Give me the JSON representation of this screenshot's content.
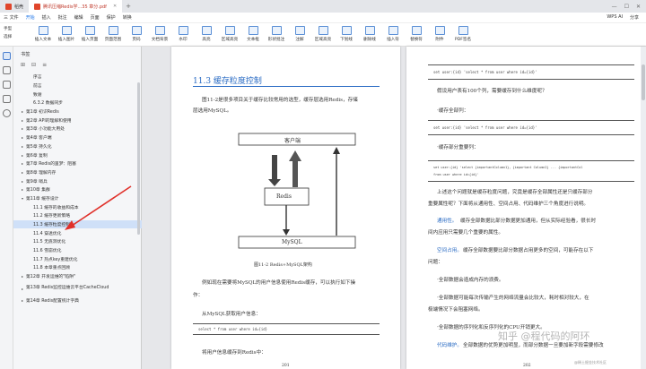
{
  "tabs": [
    {
      "label": "稻壳",
      "color": "#e0452b",
      "active": false
    },
    {
      "label": "腾讯压缩Redis学...35 章分.pdf",
      "color": "#e0452b",
      "active": true
    }
  ],
  "menubar": {
    "items": [
      "三 文件",
      "开始",
      "插入",
      "批注",
      "编辑",
      "页面",
      "保护",
      "转换"
    ],
    "right": [
      "WPS AI",
      "分享"
    ]
  },
  "ribbon": [
    {
      "label": "手型",
      "type": "col2",
      "label2": "选择"
    },
    {
      "label": "插入文本"
    },
    {
      "label": "插入图片"
    },
    {
      "label": "插入页面"
    },
    {
      "label": "页面范围"
    },
    {
      "label": "页码"
    },
    {
      "label": "文档背景"
    },
    {
      "label": "水印"
    },
    {
      "label": "高亮"
    },
    {
      "label": "区域高亮"
    },
    {
      "label": "文本框"
    },
    {
      "label": "形状批注"
    },
    {
      "label": "注解"
    },
    {
      "label": "区域高亮"
    },
    {
      "label": "下划线"
    },
    {
      "label": "删除线"
    },
    {
      "label": "插入符"
    },
    {
      "label": "替换符"
    },
    {
      "label": "附件"
    },
    {
      "label": "PDF签名"
    }
  ],
  "toc": {
    "header": "书签",
    "items": [
      {
        "label": "序言",
        "caret": "",
        "indent": 1
      },
      {
        "label": "前言",
        "caret": "",
        "indent": 1
      },
      {
        "label": "致谢",
        "caret": "",
        "indent": 1
      },
      {
        "label": "6.3.2 数据同步",
        "caret": "",
        "indent": 1
      },
      {
        "label": "第1章 初识Redis",
        "caret": "▸",
        "indent": 0
      },
      {
        "label": "第2章 API的理解和使用",
        "caret": "▸",
        "indent": 0
      },
      {
        "label": "第3章 小功能大用处",
        "caret": "▸",
        "indent": 0
      },
      {
        "label": "第4章 客户端",
        "caret": "▸",
        "indent": 0
      },
      {
        "label": "第5章 持久化",
        "caret": "▸",
        "indent": 0
      },
      {
        "label": "第6章 复制",
        "caret": "▸",
        "indent": 0
      },
      {
        "label": "第7章 Redis的噩梦：阻塞",
        "caret": "▸",
        "indent": 0
      },
      {
        "label": "第8章 理解内存",
        "caret": "▸",
        "indent": 0
      },
      {
        "label": "第9章 哨兵",
        "caret": "▸",
        "indent": 0
      },
      {
        "label": "第10章 集群",
        "caret": "▸",
        "indent": 0
      },
      {
        "label": "第11章 缓存设计",
        "caret": "▾",
        "indent": 0
      },
      {
        "label": "11.1 缓存的收益和成本",
        "caret": "",
        "indent": 1
      },
      {
        "label": "11.2 缓存更新策略",
        "caret": "",
        "indent": 1
      },
      {
        "label": "11.3 缓存粒度控制",
        "caret": "",
        "indent": 1,
        "selected": true
      },
      {
        "label": "11.4 穿透优化",
        "caret": "",
        "indent": 1
      },
      {
        "label": "11.5 无底洞优化",
        "caret": "",
        "indent": 1
      },
      {
        "label": "11.6 雪崩优化",
        "caret": "",
        "indent": 1
      },
      {
        "label": "11.7 热点key重建优化",
        "caret": "",
        "indent": 1
      },
      {
        "label": "11.8 本章重点回顾",
        "caret": "",
        "indent": 1
      },
      {
        "label": "第12章 开发运维的\"陷阱\"",
        "caret": "▸",
        "indent": 0
      },
      {
        "label": "第13章 Redis监控运维云平台CacheCloud",
        "caret": "▸",
        "indent": 0,
        "wrap": true
      },
      {
        "label": "第14章 Redis配置统计字典",
        "caret": "▸",
        "indent": 0
      }
    ]
  },
  "left_page": {
    "heading": "11.3  缓存粒度控制",
    "p1a": "图11-2是很多项目关于缓存比较常用的选型，缓存层选用Redis，存储",
    "p1b": "层选用MySQL。",
    "diagram": {
      "top": "客户端",
      "middle": "Redis",
      "bottom": "MySQL"
    },
    "caption": "图11-2   Redis+MySQL架构",
    "p2a": "例如现在需要将MySQL的用户信息使用Redis缓存，可以执行如下操",
    "p2b": "作：",
    "p3": "从MySQL获取用户信息：",
    "code": "select * from user where id={id}",
    "p4": "将用户信息缓存到Redis中：",
    "page_no": "201"
  },
  "right_page": {
    "code1": "set user:{id} 'select * from user where id={id}'",
    "p1": "假设用户表有100个列，需要缓存到什么维度呢？",
    "p2": "·缓存全部列：",
    "code2": "set user:{id} 'select * from user where id={id}'",
    "p3": "·缓存部分重要列：",
    "code3a": "set user:{id} 'select {importantColumn1}, {important Column2} ... {importantCol",
    "code3b": "from user where id={id}'",
    "p4a": "上述这个问题就是缓存粒度问题，究竟是缓存全部属性还是只缓存部分",
    "p4b": "重要属性呢？下面将从通用性、空间占用、代码维护三个角度进行说明。",
    "p5a_key": "通用性。",
    "p5a": "缓存全部数据比部分数据更加通用，但从实际经验看，很长时",
    "p5b": "间内应用只需要几个重要的属性。",
    "p6a_key": "空间占用。",
    "p6a": "缓存全部数据要比部分数据占用更多的空间，可能存在以下",
    "p6b": "问题：",
    "p7": "·全部数据会造成内存的浪费。",
    "p8a": "·全部数据可能每次传输产生的网络流量会比较大，耗时相对较大，在",
    "p8b": "极端情况下会阻塞网络。",
    "p9": "·全部数据的序列化和反序列化的CPU开销更大。",
    "p10_key": "代码维护。",
    "p10": "全部数据的优势更加明显，而部分数据一旦要加新字段需要修改",
    "page_no": "202"
  },
  "watermark": "知乎 @程代码的阿环",
  "watermark_sub": "@稀土掘金技术社区"
}
